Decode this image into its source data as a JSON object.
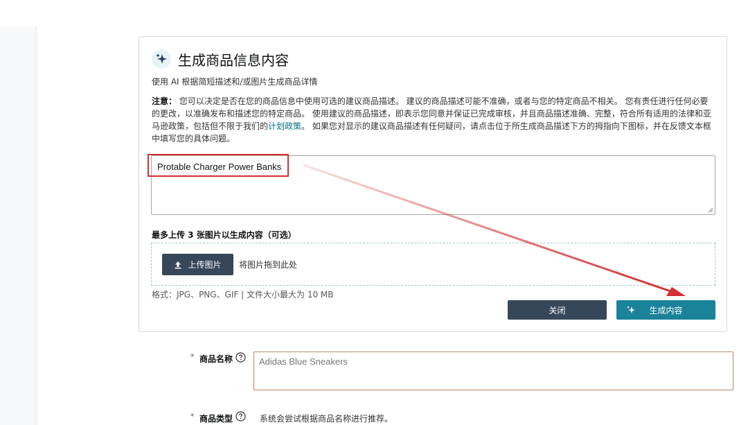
{
  "panel": {
    "title": "生成商品信息内容",
    "subtitle": "使用 AI 根据简短描述和/或图片生成商品详情",
    "notice_prefix": "注意：",
    "notice_text_1": " 您可以决定是否在您的商品信息中使用可选的建议商品描述。 建议的商品描述可能不准确，或者与您的特定商品不相关。 您有责任进行任何必要的更改，以准确发布和描述您的特定商品。 使用建议的商品描述，即表示您同意并保证已完成审核，并且商品描述准确、完整，符合所有适用的法律和亚马逊政策，包括但不限于我们的",
    "notice_link": "计划政策",
    "notice_text_2": "。 如果您对显示的建议商品描述有任何疑问，请点击位于所生成商品描述下方的拇指向下图标，并在反馈文本框中填写您的具体问题。",
    "description_value": "Protable Charger Power Banks",
    "upload_label": "最多上传 3 张图片以生成内容（可选）",
    "upload_button": "上传图片",
    "drop_hint": "将图片拖到此处",
    "format_note": "格式：JPG、PNG、GIF | 文件大小最大为 10 MB",
    "close_button": "关闭",
    "generate_button": "生成内容"
  },
  "form": {
    "required_mark": "*",
    "product_name_label": "商品名称",
    "product_name_placeholder": "Adidas Blue Sneakers",
    "product_type_label": "商品类型",
    "product_type_hint": "系统会尝试根据商品名称进行推荐。"
  },
  "colors": {
    "accent": "#1a8299",
    "dark_button": "#37475a",
    "annotation_red": "#d32f2f",
    "link": "#007185"
  },
  "icons": [
    "sparkle-icon",
    "upload-arrow-icon",
    "help-icon",
    "resize-grip-icon"
  ]
}
